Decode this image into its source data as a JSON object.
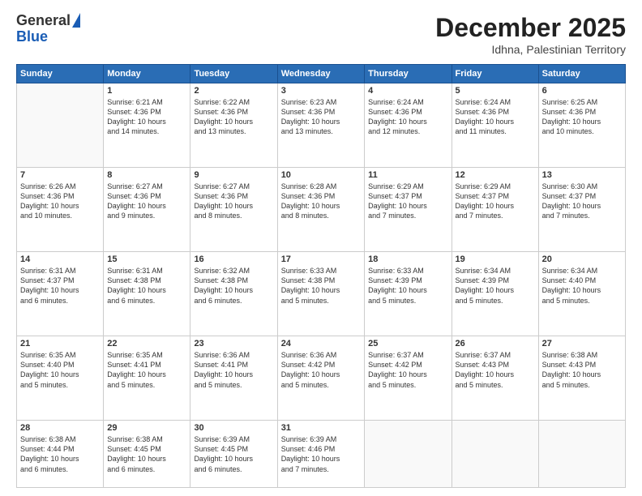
{
  "header": {
    "logo_general": "General",
    "logo_blue": "Blue",
    "month_title": "December 2025",
    "location": "Idhna, Palestinian Territory"
  },
  "weekdays": [
    "Sunday",
    "Monday",
    "Tuesday",
    "Wednesday",
    "Thursday",
    "Friday",
    "Saturday"
  ],
  "weeks": [
    [
      {
        "day": "",
        "info": ""
      },
      {
        "day": "1",
        "info": "Sunrise: 6:21 AM\nSunset: 4:36 PM\nDaylight: 10 hours\nand 14 minutes."
      },
      {
        "day": "2",
        "info": "Sunrise: 6:22 AM\nSunset: 4:36 PM\nDaylight: 10 hours\nand 13 minutes."
      },
      {
        "day": "3",
        "info": "Sunrise: 6:23 AM\nSunset: 4:36 PM\nDaylight: 10 hours\nand 13 minutes."
      },
      {
        "day": "4",
        "info": "Sunrise: 6:24 AM\nSunset: 4:36 PM\nDaylight: 10 hours\nand 12 minutes."
      },
      {
        "day": "5",
        "info": "Sunrise: 6:24 AM\nSunset: 4:36 PM\nDaylight: 10 hours\nand 11 minutes."
      },
      {
        "day": "6",
        "info": "Sunrise: 6:25 AM\nSunset: 4:36 PM\nDaylight: 10 hours\nand 10 minutes."
      }
    ],
    [
      {
        "day": "7",
        "info": "Sunrise: 6:26 AM\nSunset: 4:36 PM\nDaylight: 10 hours\nand 10 minutes."
      },
      {
        "day": "8",
        "info": "Sunrise: 6:27 AM\nSunset: 4:36 PM\nDaylight: 10 hours\nand 9 minutes."
      },
      {
        "day": "9",
        "info": "Sunrise: 6:27 AM\nSunset: 4:36 PM\nDaylight: 10 hours\nand 8 minutes."
      },
      {
        "day": "10",
        "info": "Sunrise: 6:28 AM\nSunset: 4:36 PM\nDaylight: 10 hours\nand 8 minutes."
      },
      {
        "day": "11",
        "info": "Sunrise: 6:29 AM\nSunset: 4:37 PM\nDaylight: 10 hours\nand 7 minutes."
      },
      {
        "day": "12",
        "info": "Sunrise: 6:29 AM\nSunset: 4:37 PM\nDaylight: 10 hours\nand 7 minutes."
      },
      {
        "day": "13",
        "info": "Sunrise: 6:30 AM\nSunset: 4:37 PM\nDaylight: 10 hours\nand 7 minutes."
      }
    ],
    [
      {
        "day": "14",
        "info": "Sunrise: 6:31 AM\nSunset: 4:37 PM\nDaylight: 10 hours\nand 6 minutes."
      },
      {
        "day": "15",
        "info": "Sunrise: 6:31 AM\nSunset: 4:38 PM\nDaylight: 10 hours\nand 6 minutes."
      },
      {
        "day": "16",
        "info": "Sunrise: 6:32 AM\nSunset: 4:38 PM\nDaylight: 10 hours\nand 6 minutes."
      },
      {
        "day": "17",
        "info": "Sunrise: 6:33 AM\nSunset: 4:38 PM\nDaylight: 10 hours\nand 5 minutes."
      },
      {
        "day": "18",
        "info": "Sunrise: 6:33 AM\nSunset: 4:39 PM\nDaylight: 10 hours\nand 5 minutes."
      },
      {
        "day": "19",
        "info": "Sunrise: 6:34 AM\nSunset: 4:39 PM\nDaylight: 10 hours\nand 5 minutes."
      },
      {
        "day": "20",
        "info": "Sunrise: 6:34 AM\nSunset: 4:40 PM\nDaylight: 10 hours\nand 5 minutes."
      }
    ],
    [
      {
        "day": "21",
        "info": "Sunrise: 6:35 AM\nSunset: 4:40 PM\nDaylight: 10 hours\nand 5 minutes."
      },
      {
        "day": "22",
        "info": "Sunrise: 6:35 AM\nSunset: 4:41 PM\nDaylight: 10 hours\nand 5 minutes."
      },
      {
        "day": "23",
        "info": "Sunrise: 6:36 AM\nSunset: 4:41 PM\nDaylight: 10 hours\nand 5 minutes."
      },
      {
        "day": "24",
        "info": "Sunrise: 6:36 AM\nSunset: 4:42 PM\nDaylight: 10 hours\nand 5 minutes."
      },
      {
        "day": "25",
        "info": "Sunrise: 6:37 AM\nSunset: 4:42 PM\nDaylight: 10 hours\nand 5 minutes."
      },
      {
        "day": "26",
        "info": "Sunrise: 6:37 AM\nSunset: 4:43 PM\nDaylight: 10 hours\nand 5 minutes."
      },
      {
        "day": "27",
        "info": "Sunrise: 6:38 AM\nSunset: 4:43 PM\nDaylight: 10 hours\nand 5 minutes."
      }
    ],
    [
      {
        "day": "28",
        "info": "Sunrise: 6:38 AM\nSunset: 4:44 PM\nDaylight: 10 hours\nand 6 minutes."
      },
      {
        "day": "29",
        "info": "Sunrise: 6:38 AM\nSunset: 4:45 PM\nDaylight: 10 hours\nand 6 minutes."
      },
      {
        "day": "30",
        "info": "Sunrise: 6:39 AM\nSunset: 4:45 PM\nDaylight: 10 hours\nand 6 minutes."
      },
      {
        "day": "31",
        "info": "Sunrise: 6:39 AM\nSunset: 4:46 PM\nDaylight: 10 hours\nand 7 minutes."
      },
      {
        "day": "",
        "info": ""
      },
      {
        "day": "",
        "info": ""
      },
      {
        "day": "",
        "info": ""
      }
    ]
  ]
}
